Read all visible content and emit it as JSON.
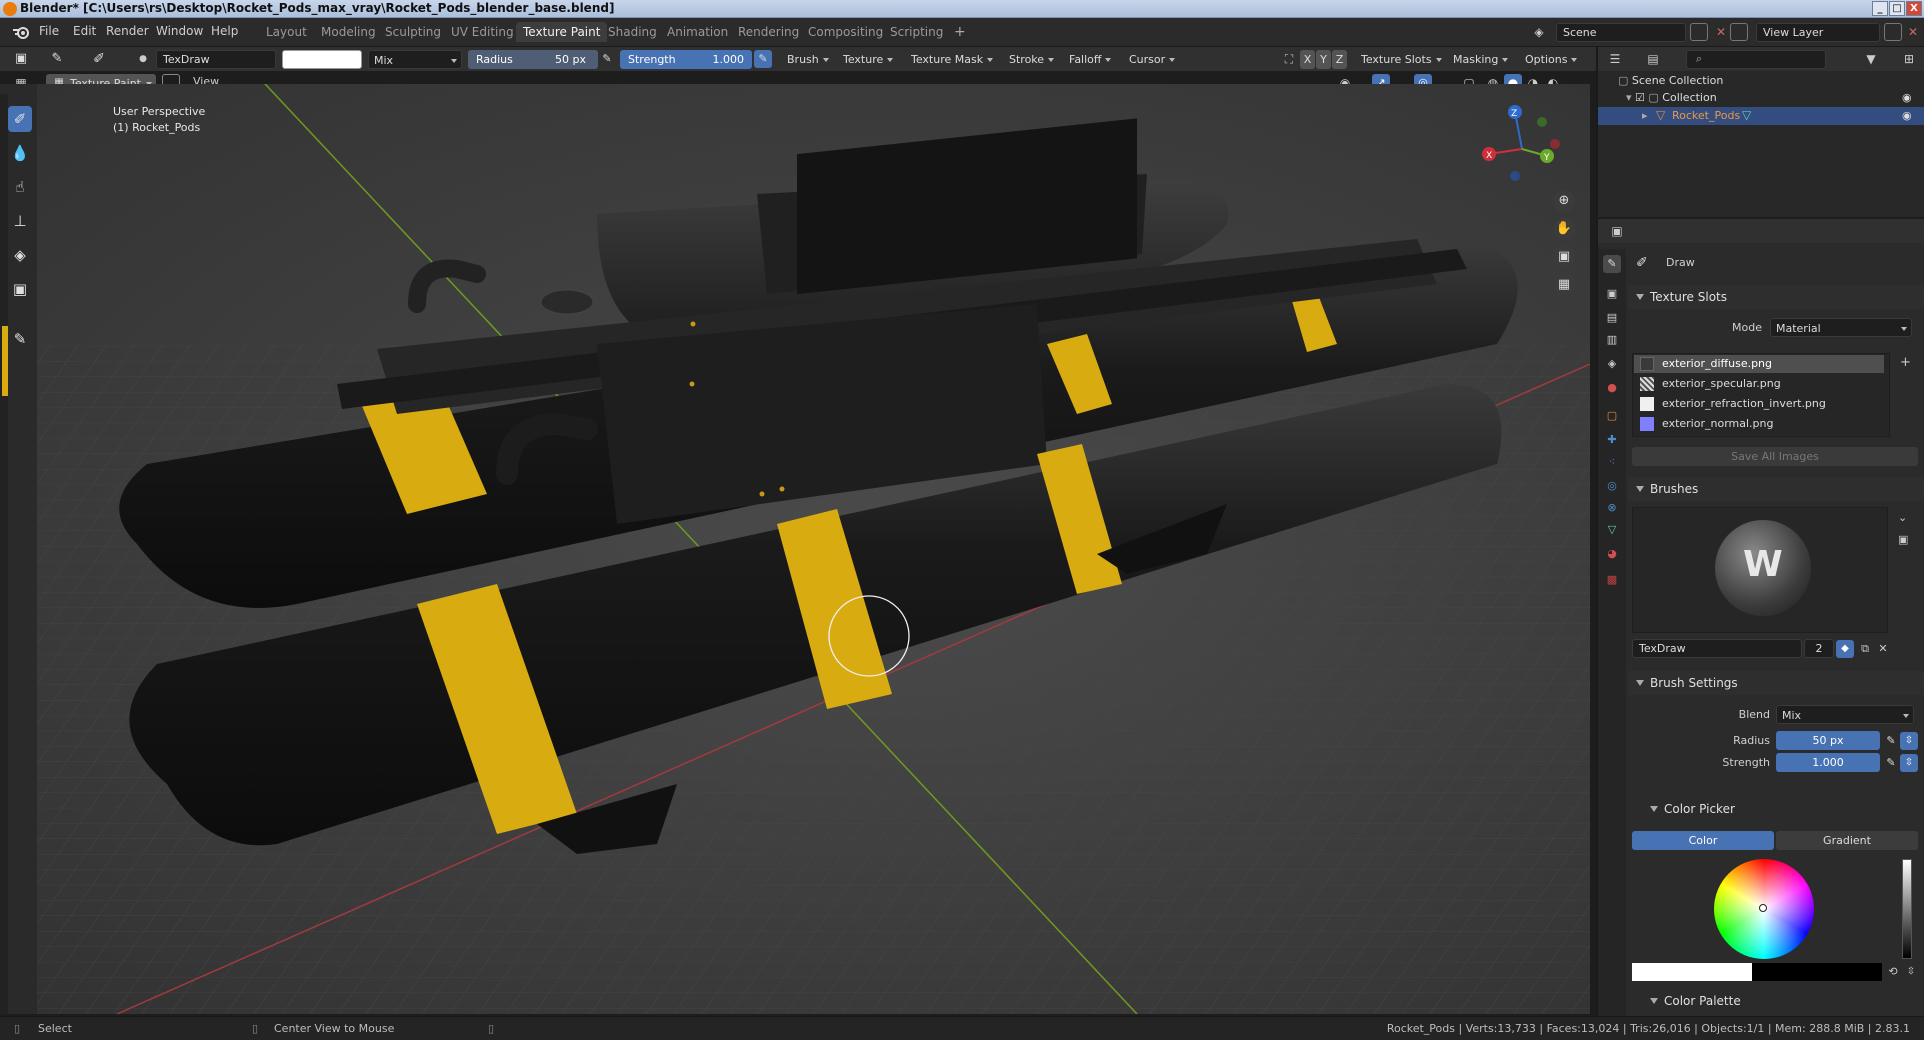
{
  "window": {
    "title": "Blender* [C:\\Users\\rs\\Desktop\\Rocket_Pods_max_vray\\Rocket_Pods_blender_base.blend]",
    "min": "_",
    "max": "□",
    "close": "X"
  },
  "menu": [
    "File",
    "Edit",
    "Render",
    "Window",
    "Help"
  ],
  "workspaces": [
    {
      "label": "Layout",
      "active": false
    },
    {
      "label": "Modeling",
      "active": false
    },
    {
      "label": "Sculpting",
      "active": false
    },
    {
      "label": "UV Editing",
      "active": false
    },
    {
      "label": "Texture Paint",
      "active": true
    },
    {
      "label": "Shading",
      "active": false
    },
    {
      "label": "Animation",
      "active": false
    },
    {
      "label": "Rendering",
      "active": false
    },
    {
      "label": "Compositing",
      "active": false
    },
    {
      "label": "Scripting",
      "active": false
    }
  ],
  "add_workspace": "+",
  "scene": {
    "name": "Scene",
    "view_layer": "View Layer"
  },
  "tool_header": {
    "brush": "TexDraw",
    "blend": "Mix",
    "radius_label": "Radius",
    "radius": "50 px",
    "strength_label": "Strength",
    "strength": "1.000",
    "menus": [
      "Brush",
      "Texture",
      "Texture Mask",
      "Stroke",
      "Falloff",
      "Cursor"
    ],
    "axes": [
      "X",
      "Y",
      "Z"
    ],
    "right_menus": [
      "Texture Slots",
      "Masking",
      "Options"
    ]
  },
  "view_header": {
    "mode": "Texture Paint",
    "view": "View"
  },
  "viewport": {
    "perspective": "User Perspective",
    "object": "(1) Rocket_Pods",
    "colors": {
      "pod_body": "#141414",
      "stripe": "#d8ac10",
      "grid": "#4a4a4a",
      "x_axis": "#a23a3f",
      "y_axis": "#6e9a1e"
    }
  },
  "gizmo": {
    "x": "X",
    "y": "Y",
    "z": "Z"
  },
  "outliner": {
    "root": "Scene Collection",
    "collection": "Collection",
    "object": "Rocket_Pods"
  },
  "properties": {
    "tool_name": "Draw",
    "texture_slots": {
      "title": "Texture Slots",
      "mode_label": "Mode",
      "mode": "Material",
      "slots": [
        "exterior_diffuse.png",
        "exterior_specular.png",
        "exterior_refraction_invert.png",
        "exterior_normal.png"
      ],
      "save_all": "Save All Images"
    },
    "brushes": {
      "title": "Brushes",
      "name": "TexDraw",
      "users": "2"
    },
    "brush_settings": {
      "title": "Brush Settings",
      "blend_label": "Blend",
      "blend": "Mix",
      "radius_label": "Radius",
      "radius": "50 px",
      "strength_label": "Strength",
      "strength": "1.000"
    },
    "color_picker": {
      "title": "Color Picker",
      "tab_color": "Color",
      "tab_gradient": "Gradient"
    },
    "color_palette": {
      "title": "Color Palette"
    }
  },
  "status": {
    "select": "Select",
    "center": "Center View to Mouse",
    "stats": "Rocket_Pods | Verts:13,733 | Faces:13,024 | Tris:26,016 | Objects:1/1 | Mem: 288.8 MiB | 2.83.1"
  },
  "accent": "#4772b3"
}
